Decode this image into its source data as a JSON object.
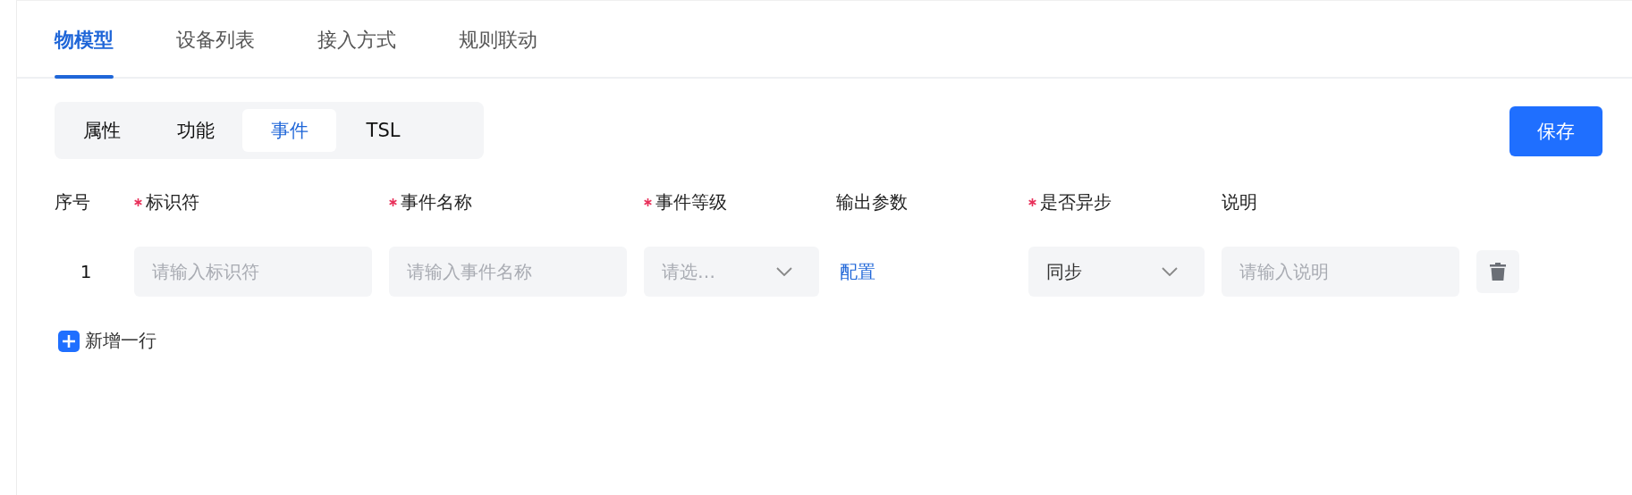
{
  "tabs": [
    {
      "label": "物模型",
      "selected": true
    },
    {
      "label": "设备列表",
      "selected": false
    },
    {
      "label": "接入方式",
      "selected": false
    },
    {
      "label": "规则联动",
      "selected": false
    }
  ],
  "segments": [
    {
      "label": "属性",
      "selected": false
    },
    {
      "label": "功能",
      "selected": false
    },
    {
      "label": "事件",
      "selected": true
    },
    {
      "label": "TSL",
      "selected": false
    }
  ],
  "save_button": "保存",
  "table": {
    "columns": [
      {
        "label": "序号",
        "required": false
      },
      {
        "label": "标识符",
        "required": true
      },
      {
        "label": "事件名称",
        "required": true
      },
      {
        "label": "事件等级",
        "required": true
      },
      {
        "label": "输出参数",
        "required": false
      },
      {
        "label": "是否异步",
        "required": true
      },
      {
        "label": "说明",
        "required": false
      }
    ],
    "rows": [
      {
        "cells": [
          {
            "kind": "index",
            "text": "1"
          },
          {
            "kind": "input",
            "placeholder": "请输入标识符"
          },
          {
            "kind": "input",
            "placeholder": "请输入事件名称"
          },
          {
            "kind": "select",
            "placeholder": "请选…"
          },
          {
            "kind": "link",
            "text": "配置"
          },
          {
            "kind": "select",
            "value": "同步"
          },
          {
            "kind": "input",
            "placeholder": "请输入说明"
          },
          {
            "kind": "delete"
          }
        ]
      }
    ]
  },
  "add_row": "新增一行"
}
